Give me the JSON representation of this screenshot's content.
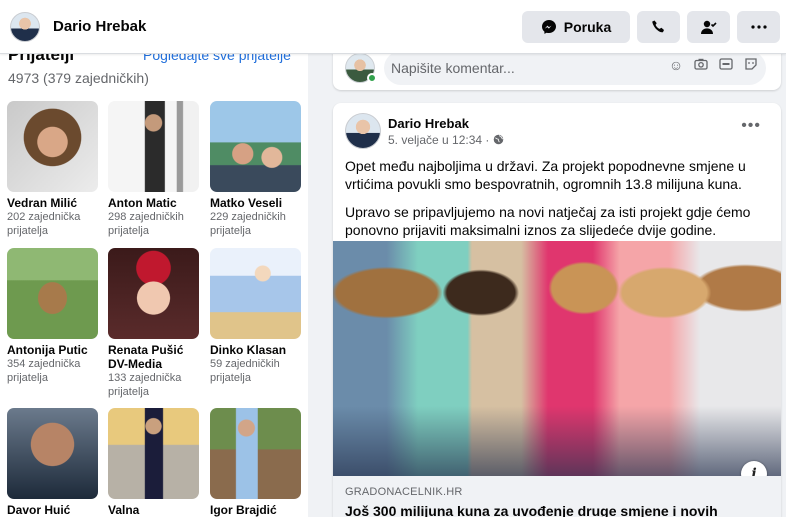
{
  "header": {
    "name": "Dario Hrebak",
    "message_button": "Poruka",
    "icons": [
      "messenger-icon",
      "phone-icon",
      "user-check-icon",
      "more-icon"
    ]
  },
  "friends": {
    "title": "Prijatelji",
    "see_all": "Pogledajte sve prijatelje",
    "count": "4973 (379 zajedničkih)",
    "items": [
      {
        "name": "Vedran Milić",
        "mutual": "202 zajednička prijatelja"
      },
      {
        "name": "Anton Matic",
        "mutual": "298 zajedničkih prijatelja"
      },
      {
        "name": "Matko Veseli",
        "mutual": "229 zajedničkih prijatelja"
      },
      {
        "name": "Antonija Putic",
        "mutual": "354 zajednička prijatelja"
      },
      {
        "name": "Renata Pušić DV-Media",
        "mutual": "133 zajednička prijatelja"
      },
      {
        "name": "Dinko Klasan",
        "mutual": "59 zajedničkih prijatelja"
      },
      {
        "name": "Davor Huić",
        "mutual": ""
      },
      {
        "name": "Valna Bastijančić",
        "mutual": ""
      },
      {
        "name": "Igor Brajdić",
        "mutual": ""
      }
    ]
  },
  "composer": {
    "placeholder": "Napišite komentar...",
    "icons": [
      "emoji-icon",
      "camera-icon",
      "gif-icon",
      "sticker-icon"
    ]
  },
  "post": {
    "author": "Dario Hrebak",
    "date": "5. veljače u 12:34 ·",
    "privacy_icon": "globe-icon",
    "paragraphs": [
      "Opet među najboljima u državi. Za projekt popodnevne smjene u vrtićima povukli smo bespovratnih, ogromnih 13.8 milijuna kuna.",
      "Upravo se pripavljujemo na novi natječaj za isti projekt gdje ćemo ponovno prijaviti maksimalni iznos za slijedeće dvije godine."
    ],
    "link_domain": "GRADONACELNIK.HR",
    "link_title": "Još 300 milijuna kuna za uvođenje druge smjene i novih"
  }
}
